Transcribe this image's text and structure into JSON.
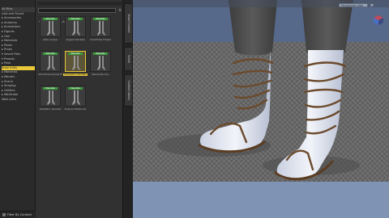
{
  "tree": {
    "items": [
      {
        "label": "All Files",
        "selected": false,
        "root": true
      },
      {
        "label": "Lost and Found",
        "selected": false
      },
      {
        "label": "▸ Accessories",
        "selected": false
      },
      {
        "label": "▸ Anatomy",
        "selected": false
      },
      {
        "label": "▸ Animations",
        "selected": false
      },
      {
        "label": "▸ Figures",
        "selected": false
      },
      {
        "label": "▸ Hair",
        "selected": false
      },
      {
        "label": "▸ Materials",
        "selected": false
      },
      {
        "label": "▸ Poses",
        "selected": false
      },
      {
        "label": "▸ Props",
        "selected": false
      },
      {
        "label": "▾ Saved Files",
        "selected": false
      },
      {
        "label": "  ▾ Presets",
        "selected": false
      },
      {
        "label": "    ▸ Pose",
        "selected": false
      },
      {
        "label": "      Shoe Edits",
        "selected": true
      },
      {
        "label": "    ▸ Materials",
        "selected": false
      },
      {
        "label": "    ▸ Morphs",
        "selected": false
      },
      {
        "label": "▸ Scene",
        "selected": false
      },
      {
        "label": "▸ Shaping",
        "selected": false
      },
      {
        "label": "▸ Utilities",
        "selected": false
      },
      {
        "label": "▸ Wardrobe",
        "selected": false
      },
      {
        "label": "  Web Links",
        "selected": false
      }
    ],
    "filter_label": "Filter By Context"
  },
  "content": {
    "sort_label": "Sort by: Name - A to Z",
    "close_glyph": "×",
    "thumbs": [
      {
        "label": "Alba Laceup",
        "badge": "Wearable",
        "selected": false
      },
      {
        "label": "Angela Sandals",
        "badge": "Wearable",
        "selected": false
      },
      {
        "label": "Christmas Flower",
        "badge": "Wearable",
        "selected": false
      },
      {
        "label": "Christmas Pumps M",
        "badge": "Wearable",
        "selected": false
      },
      {
        "label": "Cleopatra Sandals",
        "badge": "Wearable",
        "selected": true
      },
      {
        "label": "Elements (CL)",
        "badge": "Wearable",
        "selected": false
      },
      {
        "label": "Gladiator Sandals",
        "badge": "Wearable",
        "selected": false
      },
      {
        "label": "Knaiven Boots (2)",
        "badge": "Wearable",
        "selected": false
      }
    ]
  },
  "vtabs": [
    {
      "label": "Smart Content"
    },
    {
      "label": "Scene"
    },
    {
      "label": "Content Library"
    }
  ],
  "viewport": {
    "camera_label": "Perspective View",
    "menu_glyph": "≡",
    "bg_color": "#56698a",
    "floor_color": "#7f93b5"
  }
}
